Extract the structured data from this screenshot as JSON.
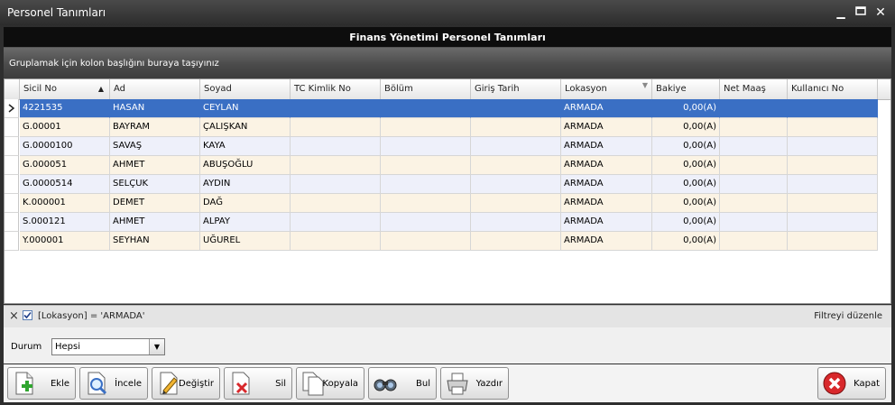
{
  "window": {
    "title": "Personel Tanımları"
  },
  "banner": {
    "title": "Finans Yönetimi Personel Tanımları"
  },
  "group_panel": {
    "hint": "Gruplamak için kolon başlığını buraya taşıyınız"
  },
  "columns": [
    "Sicil No",
    "Ad",
    "Soyad",
    "TC Kimlik No",
    "Bölüm",
    "Giriş Tarih",
    "Lokasyon",
    "Bakiye",
    "Net Maaş",
    "Kullanıcı No"
  ],
  "rows": [
    {
      "sicil": "4221535",
      "ad": "HASAN",
      "soyad": "CEYLAN",
      "tc": "",
      "bolum": "",
      "giris": "",
      "lokasyon": "ARMADA",
      "bakiye": "0,00(A)",
      "net": "",
      "kullanici": ""
    },
    {
      "sicil": "G.00001",
      "ad": "BAYRAM",
      "soyad": "ÇALIŞKAN",
      "tc": "",
      "bolum": "",
      "giris": "",
      "lokasyon": "ARMADA",
      "bakiye": "0,00(A)",
      "net": "",
      "kullanici": ""
    },
    {
      "sicil": "G.0000100",
      "ad": "SAVAŞ",
      "soyad": "KAYA",
      "tc": "",
      "bolum": "",
      "giris": "",
      "lokasyon": "ARMADA",
      "bakiye": "0,00(A)",
      "net": "",
      "kullanici": ""
    },
    {
      "sicil": "G.000051",
      "ad": "AHMET",
      "soyad": "ABUŞOĞLU",
      "tc": "",
      "bolum": "",
      "giris": "",
      "lokasyon": "ARMADA",
      "bakiye": "0,00(A)",
      "net": "",
      "kullanici": ""
    },
    {
      "sicil": "G.0000514",
      "ad": "SELÇUK",
      "soyad": "AYDIN",
      "tc": "",
      "bolum": "",
      "giris": "",
      "lokasyon": "ARMADA",
      "bakiye": "0,00(A)",
      "net": "",
      "kullanici": ""
    },
    {
      "sicil": "K.000001",
      "ad": "DEMET",
      "soyad": "DAĞ",
      "tc": "",
      "bolum": "",
      "giris": "",
      "lokasyon": "ARMADA",
      "bakiye": "0,00(A)",
      "net": "",
      "kullanici": ""
    },
    {
      "sicil": "S.000121",
      "ad": "AHMET",
      "soyad": "ALPAY",
      "tc": "",
      "bolum": "",
      "giris": "",
      "lokasyon": "ARMADA",
      "bakiye": "0,00(A)",
      "net": "",
      "kullanici": ""
    },
    {
      "sicil": "Y.000001",
      "ad": "SEYHAN",
      "soyad": "UĞUREL",
      "tc": "",
      "bolum": "",
      "giris": "",
      "lokasyon": "ARMADA",
      "bakiye": "0,00(A)",
      "net": "",
      "kullanici": ""
    }
  ],
  "filter": {
    "expression": "[Lokasyon] = 'ARMADA'",
    "edit_label": "Filtreyi düzenle",
    "close_glyph": "×"
  },
  "status": {
    "label": "Durum",
    "selected": "Hepsi"
  },
  "toolbar": {
    "ekle": "Ekle",
    "incele": "İncele",
    "degistir": "Değiştir",
    "sil": "Sil",
    "kopyala": "Kopyala",
    "bul": "Bul",
    "yazdir": "Yazdır",
    "kapat": "Kapat"
  },
  "colors": {
    "selected_row": "#3a6fc4",
    "alt_row": "#fbf3e4",
    "row_lavender": "#eef0fa",
    "close_red": "#d8282b"
  },
  "icons": {
    "indicator": "row-indicator-icon",
    "sort": "sort-ascending-icon",
    "filter": "column-filter-icon"
  }
}
